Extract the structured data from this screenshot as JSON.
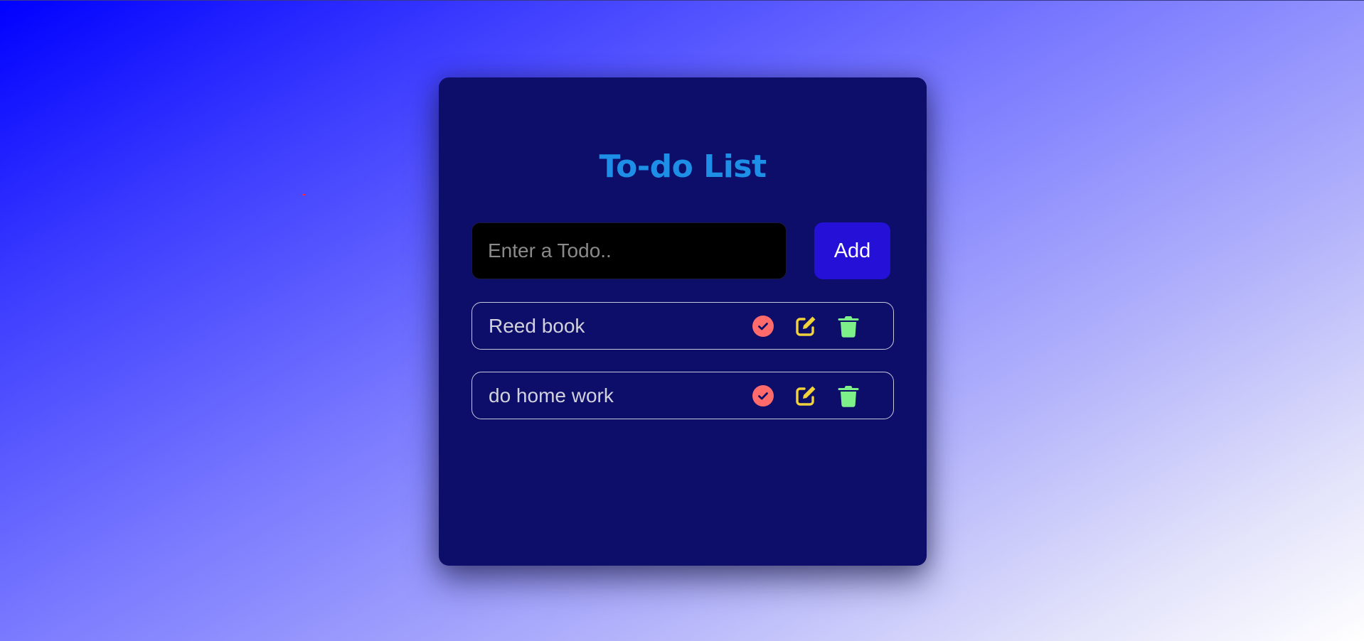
{
  "app": {
    "title": "To-do List"
  },
  "form": {
    "input_value": "",
    "input_placeholder": "Enter a Todo..",
    "add_label": "Add"
  },
  "todos": [
    {
      "text": "Reed book"
    },
    {
      "text": "do home work"
    }
  ],
  "icons": {
    "complete": "check-circle-icon",
    "edit": "pen-to-square-icon",
    "delete": "trash-icon"
  },
  "colors": {
    "background_start": "#0000ff",
    "background_end": "#ffffff",
    "card": "#0c0e6a",
    "title": "#1e8fe6",
    "add_button": "#2410d6",
    "complete_icon": "#ff6b6b",
    "edit_icon": "#f2d23c",
    "delete_icon": "#7ef08a"
  }
}
